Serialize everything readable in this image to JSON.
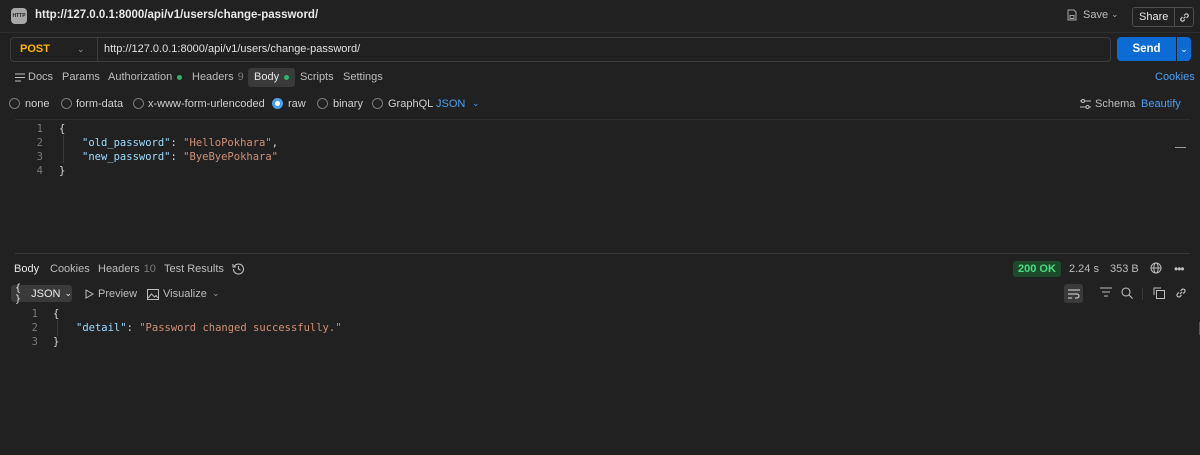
{
  "tab": {
    "title": "http://127.0.0.1:8000/api/v1/users/change-password/",
    "icon_text": "HTTP"
  },
  "header": {
    "save_label": "Save",
    "share_label": "Share"
  },
  "request": {
    "method": "POST",
    "url": "http://127.0.0.1:8000/api/v1/users/change-password/",
    "send_label": "Send"
  },
  "request_tabs": {
    "docs": "Docs",
    "params": "Params",
    "authorization": "Authorization",
    "headers": "Headers",
    "headers_count": "9",
    "body": "Body",
    "scripts": "Scripts",
    "settings": "Settings",
    "cookies": "Cookies"
  },
  "body_types": {
    "none": "none",
    "form_data": "form-data",
    "urlencoded": "x-www-form-urlencoded",
    "raw": "raw",
    "binary": "binary",
    "graphql": "GraphQL",
    "format": "JSON",
    "selected": "raw",
    "schema": "Schema",
    "beautify": "Beautify"
  },
  "request_body": {
    "line_numbers": [
      "1",
      "2",
      "3",
      "4"
    ],
    "open": "{",
    "close": "}",
    "fields": [
      {
        "key": "\"old_password\"",
        "value": "\"HelloPokhara\"",
        "trail": ","
      },
      {
        "key": "\"new_password\"",
        "value": "\"ByeByePokhara\"",
        "trail": ""
      }
    ]
  },
  "response_tabs": {
    "body": "Body",
    "cookies": "Cookies",
    "headers": "Headers",
    "headers_count": "10",
    "test_results": "Test Results"
  },
  "response_meta": {
    "status": "200 OK",
    "time": "2.24 s",
    "size": "353 B"
  },
  "response_toolbar": {
    "format": "JSON",
    "preview": "Preview",
    "visualize": "Visualize"
  },
  "response_body": {
    "line_numbers": [
      "1",
      "2",
      "3"
    ],
    "open": "{",
    "close": "}",
    "key": "\"detail\"",
    "value": "\"Password changed successfully.\""
  },
  "colors": {
    "accent": "#0d6bd6",
    "method": "#ffb400",
    "status_ok": "#4ade80",
    "link": "#4a9ff5"
  }
}
